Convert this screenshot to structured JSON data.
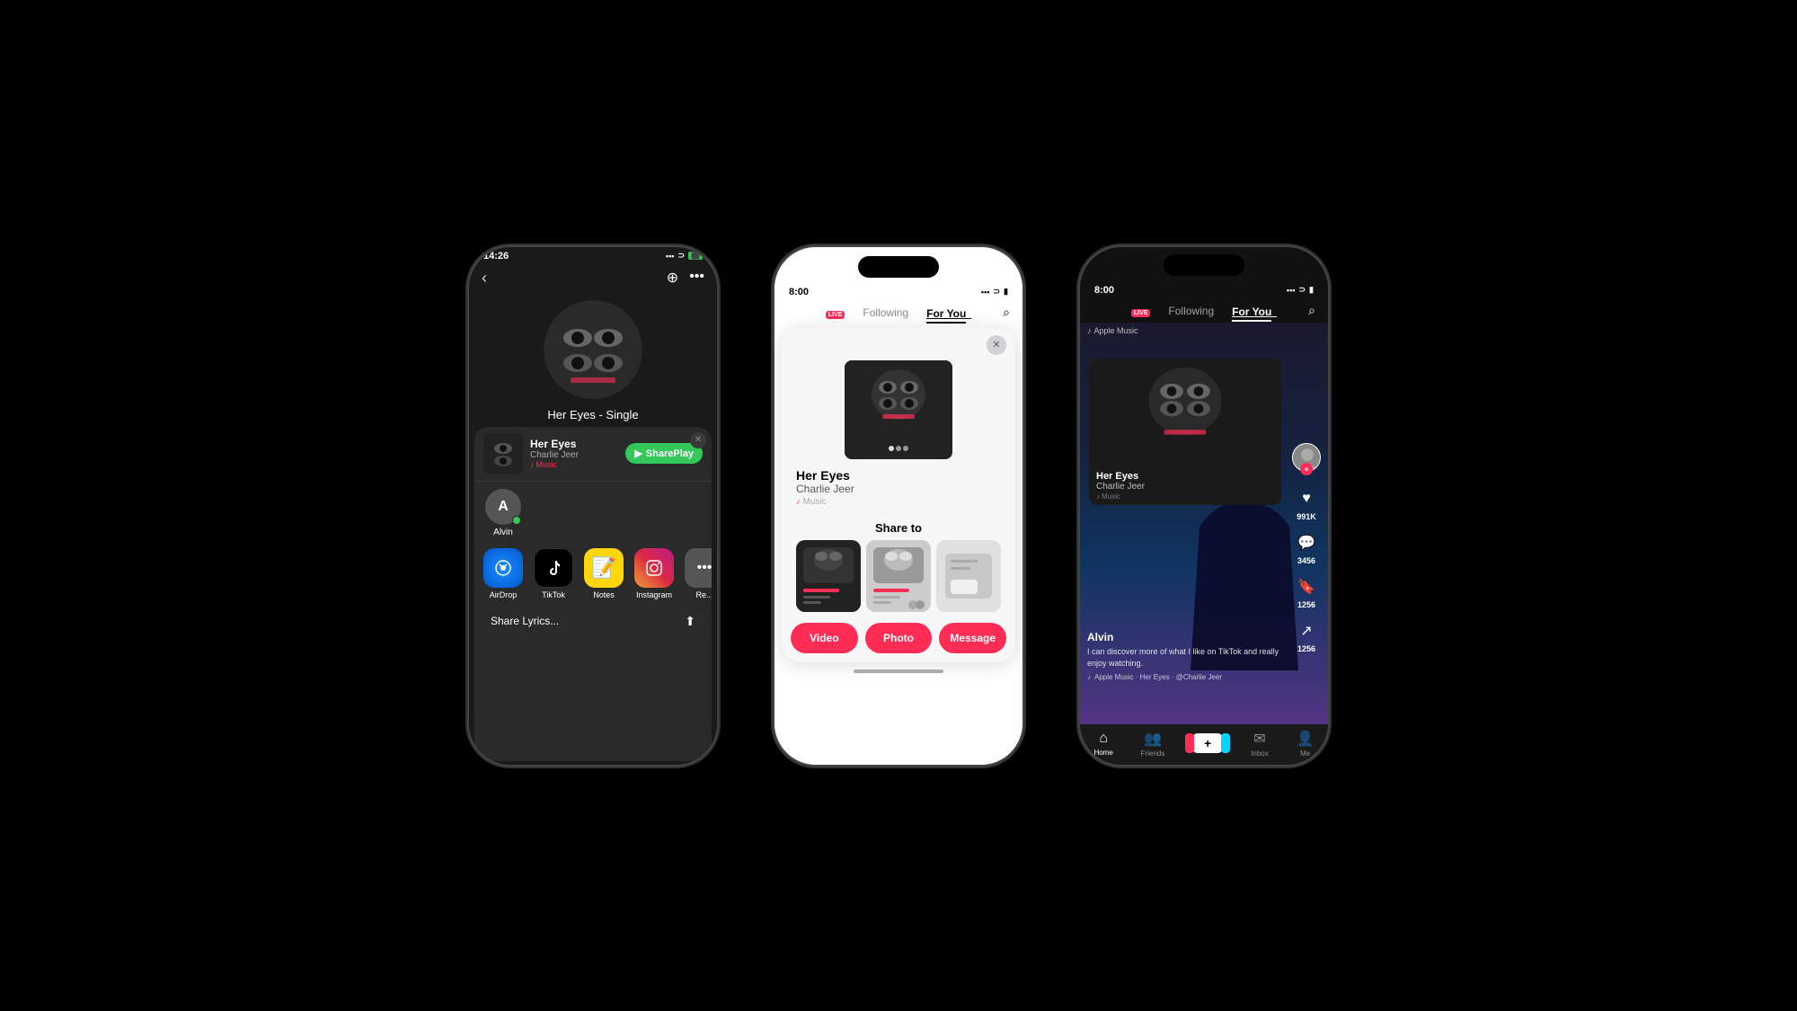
{
  "background": "#000000",
  "phones": {
    "left": {
      "statusBar": {
        "time": "14:26",
        "batteryIcon": "🔋",
        "signalBars": "●●●●",
        "wifiIcon": "WiFi",
        "batteryGreen": true
      },
      "songTitle": "Her Eyes - Single",
      "shareSheet": {
        "song": {
          "title": "Her Eyes",
          "artist": "Charlie Jeer",
          "platform": "Music"
        },
        "sharePlayLabel": "SharePlay",
        "contact": {
          "name": "Alvin",
          "initial": "A"
        },
        "apps": [
          {
            "label": "AirDrop",
            "icon": "airdrop"
          },
          {
            "label": "TikTok",
            "icon": "tiktok"
          },
          {
            "label": "Notes",
            "icon": "notes"
          },
          {
            "label": "Instagram",
            "icon": "instagram"
          },
          {
            "label": "Re...",
            "icon": "more"
          }
        ],
        "shareLyrics": "Share Lyrics..."
      }
    },
    "center": {
      "statusBar": {
        "time": "8:00",
        "batteryIcon": "🔋"
      },
      "navTabs": {
        "following": "Following",
        "forYou": "For You"
      },
      "shareCard": {
        "song": {
          "title": "Her Eyes",
          "artist": "Charlie Jeer",
          "platform": "Music"
        },
        "shareToLabel": "Share to",
        "buttons": {
          "video": "Video",
          "photo": "Photo",
          "message": "Message"
        }
      }
    },
    "right": {
      "statusBar": {
        "time": "8:00"
      },
      "navTabs": {
        "following": "Following",
        "forYou": "For You"
      },
      "albumCard": {
        "appleMusicBadge": "Apple Music",
        "title": "Her Eyes",
        "artist": "Charlie Jeer",
        "platform": "Music"
      },
      "sideActions": {
        "likeCount": "991K",
        "commentCount": "3456",
        "bookmarkCount": "1256",
        "shareCount": "1256"
      },
      "postInfo": {
        "username": "Alvin",
        "description": "I can discover more of what I like on TikTok\nand really enjoy watching.",
        "musicCredit": "Apple Music · Her Eyes · @Charlie Jeer"
      },
      "bottomNav": {
        "home": "Home",
        "friends": "Friends",
        "inbox": "Inbox",
        "me": "Me"
      }
    }
  }
}
